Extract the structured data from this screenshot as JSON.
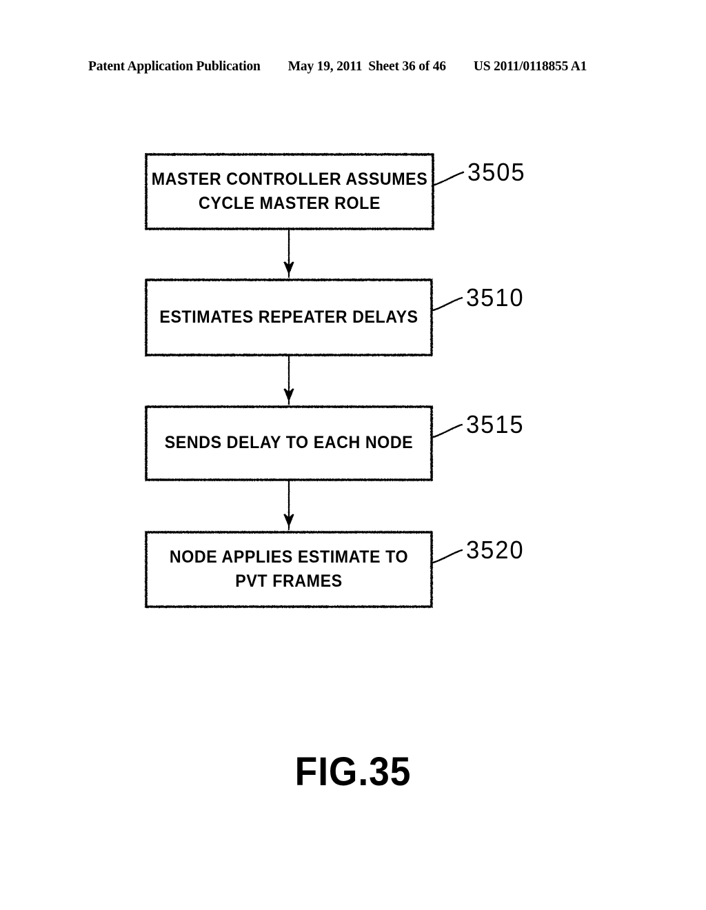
{
  "header": {
    "publication": "Patent Application Publication",
    "date": "May 19, 2011",
    "sheet": "Sheet 36 of 46",
    "document_number": "US 2011/0118855 A1"
  },
  "figure": {
    "caption": "FIG.35",
    "ink_color": "#000000",
    "background_color": "#ffffff",
    "boxes": [
      {
        "id": "step-3505",
        "ref": "3505",
        "lines": [
          "MASTER CONTROLLER ASSUMES",
          "CYCLE MASTER ROLE"
        ]
      },
      {
        "id": "step-3510",
        "ref": "3510",
        "lines": [
          "ESTIMATES REPEATER DELAYS"
        ]
      },
      {
        "id": "step-3515",
        "ref": "3515",
        "lines": [
          "SENDS DELAY TO EACH NODE"
        ]
      },
      {
        "id": "step-3520",
        "ref": "3520",
        "lines": [
          "NODE APPLIES ESTIMATE TO",
          "PVT FRAMES"
        ]
      }
    ]
  }
}
